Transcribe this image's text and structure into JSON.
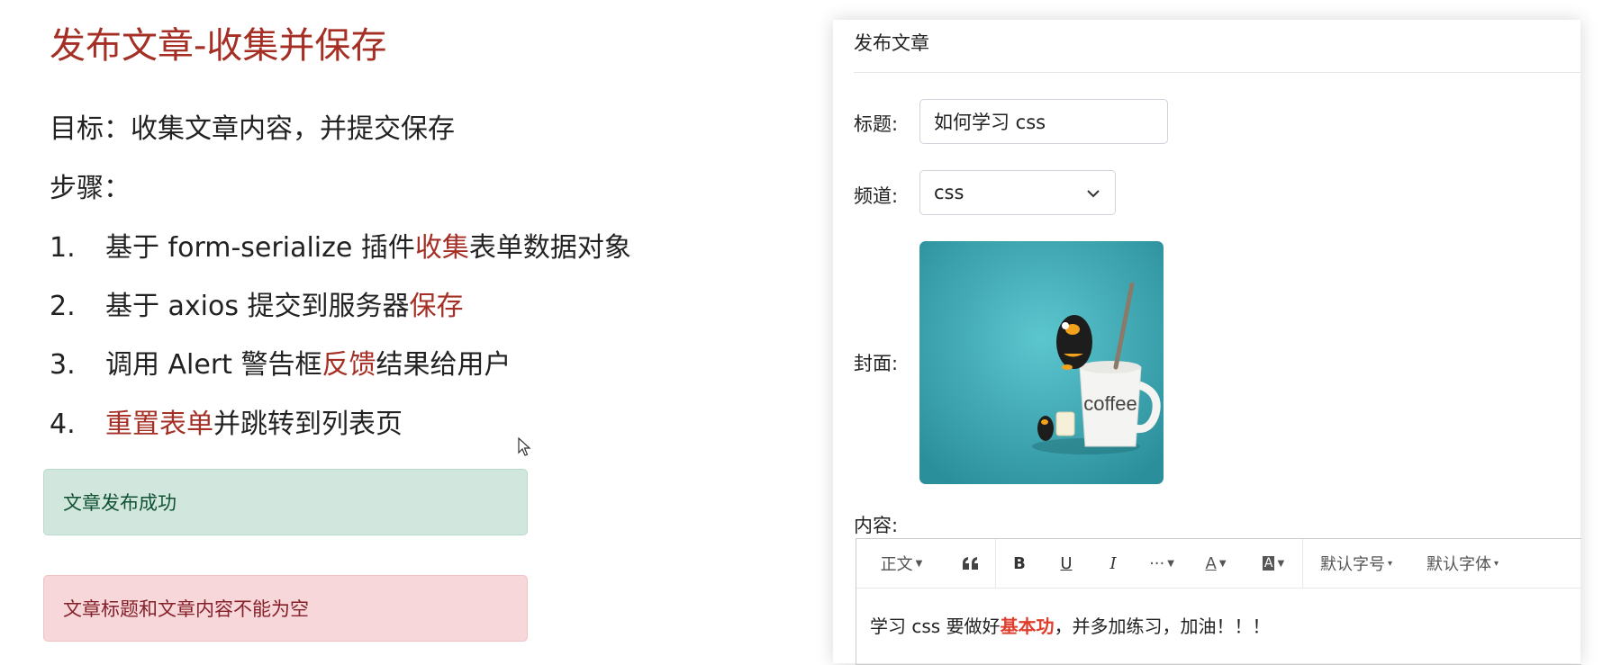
{
  "slide": {
    "title": "发布文章-收集并保存",
    "goal": "目标：收集文章内容，并提交保存",
    "steps_label": "步骤：",
    "steps": [
      {
        "num": "1.",
        "before": "基于 form-serialize 插件",
        "highlight": "收集",
        "after": "表单数据对象"
      },
      {
        "num": "2.",
        "before": "基于 axios 提交到服务器",
        "highlight": "保存",
        "after": ""
      },
      {
        "num": "3.",
        "before": "调用 Alert 警告框",
        "highlight": "反馈",
        "after": "结果给用户"
      },
      {
        "num": "4.",
        "before": "",
        "highlight": "重置表单",
        "after": "并跳转到列表页"
      }
    ],
    "alerts": {
      "success": "文章发布成功",
      "danger": "文章标题和文章内容不能为空"
    }
  },
  "form": {
    "header": "发布文章",
    "title_label": "标题:",
    "title_value": "如何学习 css",
    "channel_label": "频道:",
    "channel_value": "css",
    "cover_label": "封面:",
    "cover_text": "coffee",
    "content_label": "内容:",
    "toolbar": {
      "paragraph": "正文",
      "quote_icon": "quote-icon",
      "bold_icon": "bold-icon",
      "underline_icon": "underline-icon",
      "italic_icon": "italic-icon",
      "more_icon": "more-icon",
      "font_color_icon": "font-color-icon",
      "bg_color_icon": "background-color-icon",
      "font_size": "默认字号",
      "font_family": "默认字体"
    },
    "content": {
      "before": "学习 css 要做好",
      "emphasis": "基本功",
      "after": "，并多加练习，加油！！！"
    }
  },
  "colors": {
    "highlight": "#a52f25",
    "success_bg": "#d1e7dd",
    "danger_bg": "#f8d7da",
    "cover_bg": "#3aa9b5",
    "editor_emphasis": "#e03e2d"
  }
}
